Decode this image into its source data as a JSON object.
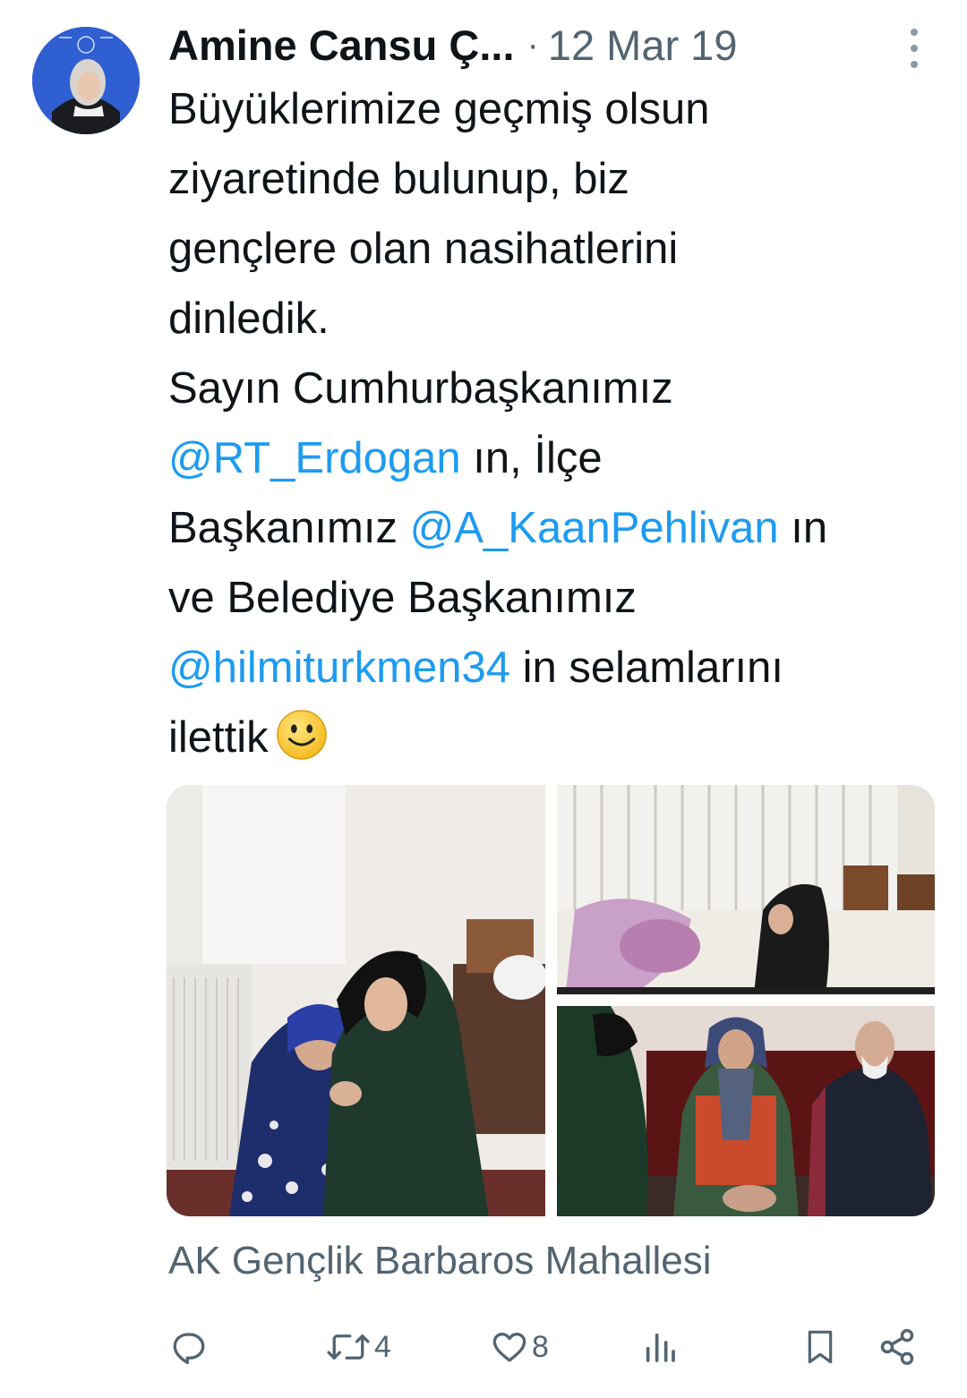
{
  "tweet": {
    "author_name": "Amine Cansu Ç...",
    "separator": "·",
    "timestamp": "12 Mar 19",
    "text": {
      "line1": "Büyüklerimize geçmiş olsun",
      "line2": "ziyaretinde bulunup, biz",
      "line3": "gençlere olan nasihatlerini",
      "line4": "dinledik.",
      "line5": "Sayın Cumhurbaşkanımız",
      "mention1": "@RT_Erdogan",
      "after_mention1": " ın, İlçe",
      "line7_start": "Başkanımız ",
      "mention2": "@A_KaanPehlivan",
      "after_mention2": " ın",
      "line8": "ve Belediye Başkanımız",
      "mention3": "@hilmiturkmen34",
      "after_mention3": " in selamlarını",
      "line10": "ilettik"
    },
    "location": "AK Gençlik Barbaros Mahallesi",
    "stats": {
      "retweets": "4",
      "likes": "8"
    }
  },
  "icons": {
    "more": "more-vertical-icon",
    "reply": "reply-icon",
    "retweet": "retweet-icon",
    "like": "heart-icon",
    "views": "analytics-icon",
    "bookmark": "bookmark-icon",
    "share": "share-icon",
    "emoji": "smiling-face-emoji"
  },
  "colors": {
    "text": "#0f1419",
    "secondary": "#536471",
    "mention": "#1d9bf0"
  }
}
